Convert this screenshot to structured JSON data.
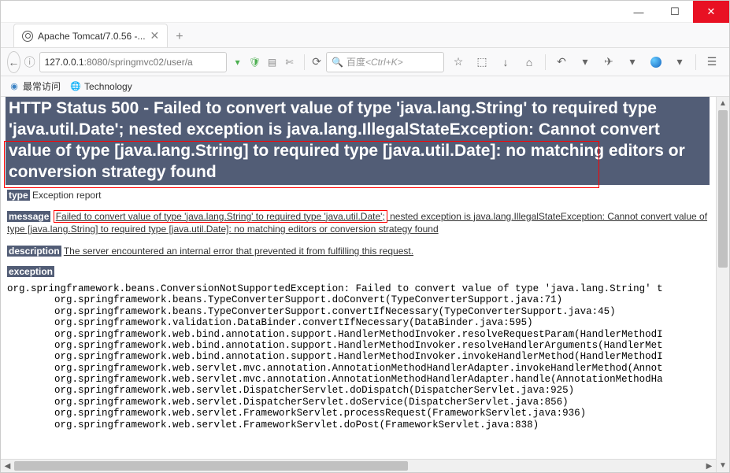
{
  "window": {
    "min": "—",
    "max": "☐",
    "close": "✕"
  },
  "tab": {
    "title": "Apache Tomcat/7.0.56 -..."
  },
  "url": {
    "prefix": "127.0.0.1",
    "port": ":8080",
    "path": "/springmvc02/user/a"
  },
  "search": {
    "label": "百度 ",
    "hint": "<Ctrl+K>"
  },
  "bookmarks": {
    "most": "最常访问",
    "tech": "Technology"
  },
  "error": {
    "heading": "HTTP Status 500 - Failed to convert value of type 'java.lang.String' to required type 'java.util.Date'; nested exception is java.lang.IllegalStateException: Cannot convert value of type [java.lang.String] to required type [java.util.Date]: no matching editors or conversion strategy found",
    "type_label": "type",
    "type_value": " Exception report",
    "message_label": "message",
    "message_boxed": "Failed to convert value of type 'java.lang.String' to required type 'java.util.Date';",
    "message_rest": " nested exception is java.lang.IllegalStateException: Cannot convert value of type [java.lang.String] to required type [java.util.Date]: no matching editors or conversion strategy found",
    "description_label": "description",
    "description_value": "The server encountered an internal error that prevented it from fulfilling this request.",
    "exception_label": "exception",
    "stack": "org.springframework.beans.ConversionNotSupportedException: Failed to convert value of type 'java.lang.String' t\n\torg.springframework.beans.TypeConverterSupport.doConvert(TypeConverterSupport.java:71)\n\torg.springframework.beans.TypeConverterSupport.convertIfNecessary(TypeConverterSupport.java:45)\n\torg.springframework.validation.DataBinder.convertIfNecessary(DataBinder.java:595)\n\torg.springframework.web.bind.annotation.support.HandlerMethodInvoker.resolveRequestParam(HandlerMethodI\n\torg.springframework.web.bind.annotation.support.HandlerMethodInvoker.resolveHandlerArguments(HandlerMet\n\torg.springframework.web.bind.annotation.support.HandlerMethodInvoker.invokeHandlerMethod(HandlerMethodI\n\torg.springframework.web.servlet.mvc.annotation.AnnotationMethodHandlerAdapter.invokeHandlerMethod(Annot\n\torg.springframework.web.servlet.mvc.annotation.AnnotationMethodHandlerAdapter.handle(AnnotationMethodHa\n\torg.springframework.web.servlet.DispatcherServlet.doDispatch(DispatcherServlet.java:925)\n\torg.springframework.web.servlet.DispatcherServlet.doService(DispatcherServlet.java:856)\n\torg.springframework.web.servlet.FrameworkServlet.processRequest(FrameworkServlet.java:936)\n\torg.springframework.web.servlet.FrameworkServlet.doPost(FrameworkServlet.java:838)"
  }
}
